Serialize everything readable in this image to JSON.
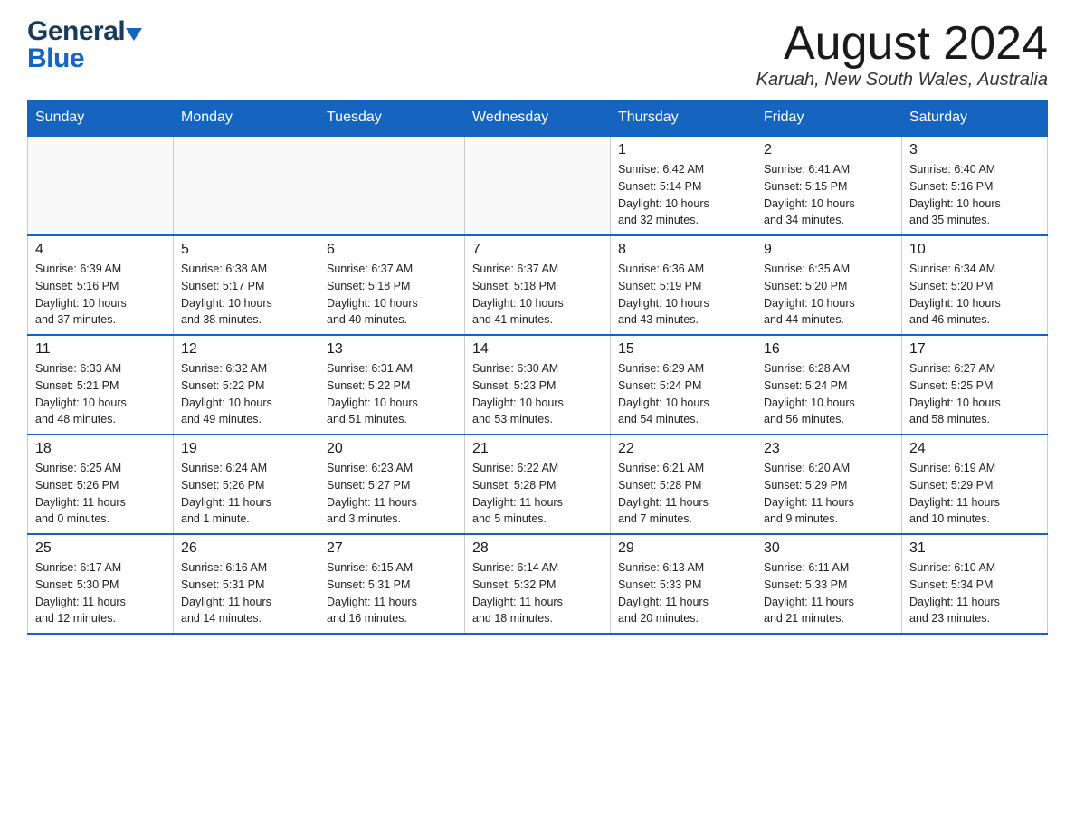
{
  "header": {
    "logo_line1": "General",
    "logo_line2": "Blue",
    "month_year": "August 2024",
    "location": "Karuah, New South Wales, Australia"
  },
  "weekdays": [
    "Sunday",
    "Monday",
    "Tuesday",
    "Wednesday",
    "Thursday",
    "Friday",
    "Saturday"
  ],
  "weeks": [
    [
      {
        "day": "",
        "info": ""
      },
      {
        "day": "",
        "info": ""
      },
      {
        "day": "",
        "info": ""
      },
      {
        "day": "",
        "info": ""
      },
      {
        "day": "1",
        "info": "Sunrise: 6:42 AM\nSunset: 5:14 PM\nDaylight: 10 hours\nand 32 minutes."
      },
      {
        "day": "2",
        "info": "Sunrise: 6:41 AM\nSunset: 5:15 PM\nDaylight: 10 hours\nand 34 minutes."
      },
      {
        "day": "3",
        "info": "Sunrise: 6:40 AM\nSunset: 5:16 PM\nDaylight: 10 hours\nand 35 minutes."
      }
    ],
    [
      {
        "day": "4",
        "info": "Sunrise: 6:39 AM\nSunset: 5:16 PM\nDaylight: 10 hours\nand 37 minutes."
      },
      {
        "day": "5",
        "info": "Sunrise: 6:38 AM\nSunset: 5:17 PM\nDaylight: 10 hours\nand 38 minutes."
      },
      {
        "day": "6",
        "info": "Sunrise: 6:37 AM\nSunset: 5:18 PM\nDaylight: 10 hours\nand 40 minutes."
      },
      {
        "day": "7",
        "info": "Sunrise: 6:37 AM\nSunset: 5:18 PM\nDaylight: 10 hours\nand 41 minutes."
      },
      {
        "day": "8",
        "info": "Sunrise: 6:36 AM\nSunset: 5:19 PM\nDaylight: 10 hours\nand 43 minutes."
      },
      {
        "day": "9",
        "info": "Sunrise: 6:35 AM\nSunset: 5:20 PM\nDaylight: 10 hours\nand 44 minutes."
      },
      {
        "day": "10",
        "info": "Sunrise: 6:34 AM\nSunset: 5:20 PM\nDaylight: 10 hours\nand 46 minutes."
      }
    ],
    [
      {
        "day": "11",
        "info": "Sunrise: 6:33 AM\nSunset: 5:21 PM\nDaylight: 10 hours\nand 48 minutes."
      },
      {
        "day": "12",
        "info": "Sunrise: 6:32 AM\nSunset: 5:22 PM\nDaylight: 10 hours\nand 49 minutes."
      },
      {
        "day": "13",
        "info": "Sunrise: 6:31 AM\nSunset: 5:22 PM\nDaylight: 10 hours\nand 51 minutes."
      },
      {
        "day": "14",
        "info": "Sunrise: 6:30 AM\nSunset: 5:23 PM\nDaylight: 10 hours\nand 53 minutes."
      },
      {
        "day": "15",
        "info": "Sunrise: 6:29 AM\nSunset: 5:24 PM\nDaylight: 10 hours\nand 54 minutes."
      },
      {
        "day": "16",
        "info": "Sunrise: 6:28 AM\nSunset: 5:24 PM\nDaylight: 10 hours\nand 56 minutes."
      },
      {
        "day": "17",
        "info": "Sunrise: 6:27 AM\nSunset: 5:25 PM\nDaylight: 10 hours\nand 58 minutes."
      }
    ],
    [
      {
        "day": "18",
        "info": "Sunrise: 6:25 AM\nSunset: 5:26 PM\nDaylight: 11 hours\nand 0 minutes."
      },
      {
        "day": "19",
        "info": "Sunrise: 6:24 AM\nSunset: 5:26 PM\nDaylight: 11 hours\nand 1 minute."
      },
      {
        "day": "20",
        "info": "Sunrise: 6:23 AM\nSunset: 5:27 PM\nDaylight: 11 hours\nand 3 minutes."
      },
      {
        "day": "21",
        "info": "Sunrise: 6:22 AM\nSunset: 5:28 PM\nDaylight: 11 hours\nand 5 minutes."
      },
      {
        "day": "22",
        "info": "Sunrise: 6:21 AM\nSunset: 5:28 PM\nDaylight: 11 hours\nand 7 minutes."
      },
      {
        "day": "23",
        "info": "Sunrise: 6:20 AM\nSunset: 5:29 PM\nDaylight: 11 hours\nand 9 minutes."
      },
      {
        "day": "24",
        "info": "Sunrise: 6:19 AM\nSunset: 5:29 PM\nDaylight: 11 hours\nand 10 minutes."
      }
    ],
    [
      {
        "day": "25",
        "info": "Sunrise: 6:17 AM\nSunset: 5:30 PM\nDaylight: 11 hours\nand 12 minutes."
      },
      {
        "day": "26",
        "info": "Sunrise: 6:16 AM\nSunset: 5:31 PM\nDaylight: 11 hours\nand 14 minutes."
      },
      {
        "day": "27",
        "info": "Sunrise: 6:15 AM\nSunset: 5:31 PM\nDaylight: 11 hours\nand 16 minutes."
      },
      {
        "day": "28",
        "info": "Sunrise: 6:14 AM\nSunset: 5:32 PM\nDaylight: 11 hours\nand 18 minutes."
      },
      {
        "day": "29",
        "info": "Sunrise: 6:13 AM\nSunset: 5:33 PM\nDaylight: 11 hours\nand 20 minutes."
      },
      {
        "day": "30",
        "info": "Sunrise: 6:11 AM\nSunset: 5:33 PM\nDaylight: 11 hours\nand 21 minutes."
      },
      {
        "day": "31",
        "info": "Sunrise: 6:10 AM\nSunset: 5:34 PM\nDaylight: 11 hours\nand 23 minutes."
      }
    ]
  ]
}
